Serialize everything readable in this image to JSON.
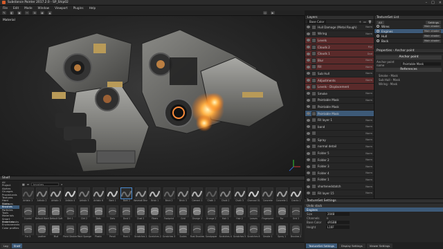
{
  "window": {
    "title": "Substance Painter 2017.2.0 - SP_Ship02"
  },
  "menu": [
    "File",
    "Edit",
    "Mode",
    "Window",
    "Viewport",
    "Plugins",
    "Help"
  ],
  "viewport": {
    "label": "Material"
  },
  "layers_panel": {
    "title": "Layers",
    "mode": "Base Color",
    "rows": [
      {
        "name": "Hull Damage (Metal Rough)",
        "blend": "Norm",
        "style": ""
      },
      {
        "name": "Wiring",
        "blend": "Norm",
        "style": ""
      },
      {
        "name": "Levels",
        "blend": "",
        "style": "red"
      },
      {
        "name": "Clouds 2",
        "blend": "Mul",
        "style": "red"
      },
      {
        "name": "Clouds 1",
        "blend": "Dod",
        "style": "red"
      },
      {
        "name": "Blur",
        "blend": "Norm",
        "style": "red"
      },
      {
        "name": "Fill",
        "blend": "Norm",
        "style": "red"
      },
      {
        "name": "Sub Hull",
        "blend": "Norm",
        "style": ""
      },
      {
        "name": "Adjustments",
        "blend": "Norm",
        "style": "red"
      },
      {
        "name": "Levels - Displacement",
        "blend": "",
        "style": "red"
      },
      {
        "name": "Smoke",
        "blend": "Norm",
        "style": ""
      },
      {
        "name": "Paintable Mask",
        "blend": "Norm",
        "style": ""
      },
      {
        "name": "Paintable Mask",
        "blend": "",
        "style": ""
      },
      {
        "name": "Paintable Mask",
        "blend": "",
        "style": "hi"
      },
      {
        "name": "Fill layer 1",
        "blend": "Norm",
        "style": ""
      },
      {
        "name": "band",
        "blend": "Norm",
        "style": ""
      },
      {
        "name": "",
        "blend": "Norm",
        "style": ""
      },
      {
        "name": "Spray",
        "blend": "Norm",
        "style": ""
      },
      {
        "name": "normal detail",
        "blend": "Norm",
        "style": ""
      },
      {
        "name": "Folder 5",
        "blend": "Norm",
        "style": ""
      },
      {
        "name": "Folder 2",
        "blend": "Norm",
        "style": ""
      },
      {
        "name": "Folder 3",
        "blend": "Norm",
        "style": ""
      },
      {
        "name": "Folder 4",
        "blend": "Norm",
        "style": ""
      },
      {
        "name": "Folder 1",
        "blend": "Norm",
        "style": ""
      },
      {
        "name": "shortenedstatch",
        "blend": "Norm",
        "style": ""
      },
      {
        "name": "Fill layer 15",
        "blend": "Norm",
        "style": ""
      }
    ]
  },
  "texture_set_list": {
    "title": "TextureSet List",
    "settings_label": "Settings",
    "all_label": "All",
    "items": [
      {
        "name": "Wires",
        "shader": "Main shader",
        "selected": false
      },
      {
        "name": "Engines",
        "shader": "Main shader",
        "selected": true
      },
      {
        "name": "Hull",
        "shader": "Main shader",
        "selected": false
      },
      {
        "name": "Back",
        "shader": "Main shader",
        "selected": false
      }
    ]
  },
  "properties": {
    "title": "Properties - Anchor point",
    "section1": "Anchor point",
    "rows": [
      {
        "k": "Anchor point name",
        "v": "Paintable Mask"
      }
    ],
    "section2": "References",
    "refs": [
      "Smoke - Mask",
      "Sub Hull - Mask",
      "Wiring - Mask"
    ]
  },
  "shelf": {
    "title": "Shelf",
    "search_placeholder": "brushes",
    "categories": [
      "All",
      "Project",
      "Alphas",
      "Grunges",
      "Procedurals",
      "Textures",
      "Hard Surfaces",
      "Filters",
      "Brushes",
      "Particles",
      "Tools",
      "Materials",
      "Smart materials",
      "Smart masks",
      "Environments",
      "Color profiles"
    ],
    "selected_category": "Brushes",
    "items": [
      "Artistic 1",
      "Artistic 2",
      "Artistic 3",
      "Artistic 4",
      "Artistic 5",
      "Artistic 6",
      "Bark 1",
      "Bark 2",
      "Basmati Brush",
      "Brick 1",
      "Brick 2",
      "Brick 3",
      "Cement 1",
      "Chalk 1",
      "Chalk 2",
      "Chalk 3",
      "Charcoal 01",
      "Concrete",
      "Concrete 1",
      "Cracks 1",
      "Crystal",
      "Default Hard",
      "Default Soft",
      "Dirt 1",
      "Dirt 2",
      "Dots",
      "Dots",
      "Dust 1",
      "Dust 2",
      "Fibers",
      "Footprint",
      "Grid",
      "Grunge 1",
      "Grunge 2",
      "Hair 1",
      "Hair 2",
      "Leaves",
      "Fingerprint",
      "Fur",
      "Grid 2",
      "Fur 3",
      "Leather",
      "Mud",
      "Paint Strokes",
      "Paint Sponge",
      "Plastic",
      "Pencil",
      "Rust 1",
      "Scratches 1",
      "Scratches 2",
      "Scratches 3",
      "Scales",
      "Rust Brushes",
      "Sandpaper",
      "Scratches 4",
      "Scratches 5",
      "Scratches 6",
      "Smoke 1",
      "Spray 1",
      "Brushes 2"
    ],
    "selected_item": "Bark 2"
  },
  "statusbar": {
    "tabs": [
      "Log",
      "Shelf"
    ],
    "active": "Shelf"
  },
  "tss": {
    "title": "TextureSet Settings",
    "undo_label": "Undo stack",
    "texture_set": "Engines",
    "rows": [
      {
        "k": "Size",
        "v": "2048"
      },
      {
        "k": "Channels",
        "v": ""
      },
      {
        "k": "Base Color",
        "v": "sRGB8"
      },
      {
        "k": "Height",
        "v": "L16F"
      }
    ]
  },
  "bottom_tabs": [
    "TextureSet Settings",
    "Display Settings",
    "Viewer Settings"
  ],
  "colors": {
    "accent": "#3d5a78",
    "layer_red": "#5a2a2a",
    "panel": "#262626",
    "glow": "#ffb347"
  }
}
